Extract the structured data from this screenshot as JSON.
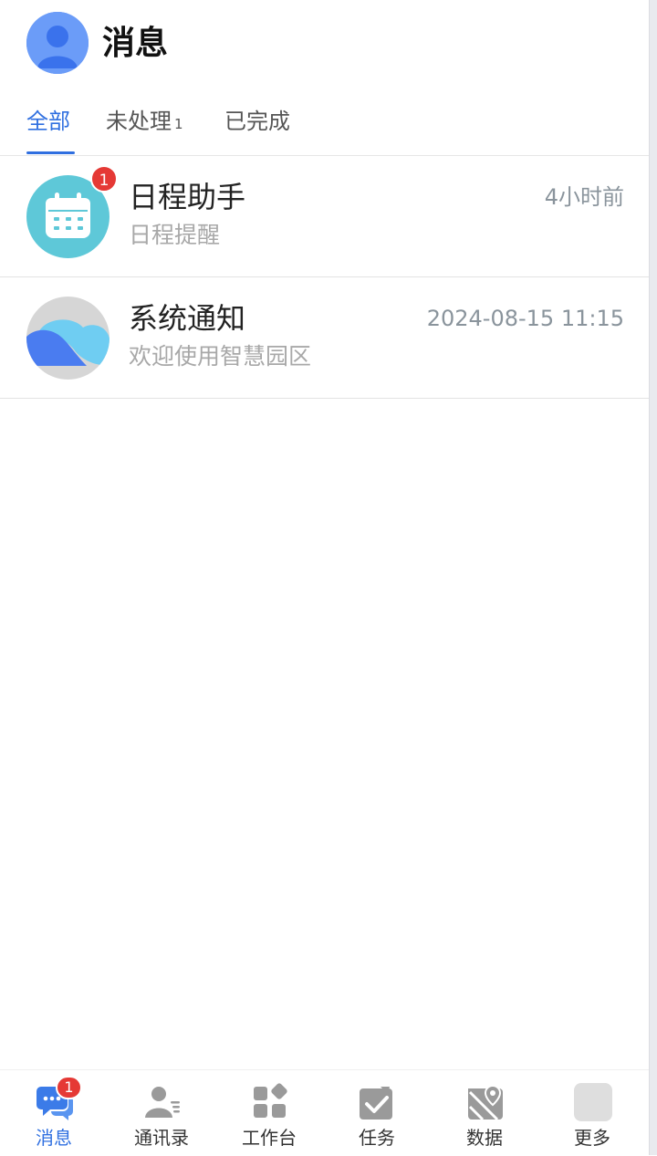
{
  "header": {
    "title": "消息"
  },
  "tabs": [
    {
      "label": "全部",
      "count": ""
    },
    {
      "label": "未处理",
      "count": "1"
    },
    {
      "label": "已完成",
      "count": ""
    }
  ],
  "messages": [
    {
      "title": "日程助手",
      "subtitle": "日程提醒",
      "time": "4小时前",
      "badge": "1",
      "icon": "calendar-icon"
    },
    {
      "title": "系统通知",
      "subtitle": "欢迎使用智慧园区",
      "time": "2024-08-15 11:15",
      "icon": "system-cloud-icon"
    }
  ],
  "nav": [
    {
      "label": "消息",
      "badge": "1",
      "icon": "chat-icon"
    },
    {
      "label": "通讯录",
      "icon": "contacts-icon"
    },
    {
      "label": "工作台",
      "icon": "workbench-icon"
    },
    {
      "label": "任务",
      "icon": "task-check-icon"
    },
    {
      "label": "数据",
      "icon": "map-pin-icon"
    },
    {
      "label": "更多",
      "icon": "more-icon"
    }
  ],
  "colors": {
    "accent": "#2f6fe0",
    "badge": "#e53935",
    "calendar_bg": "#5ec8d8"
  }
}
